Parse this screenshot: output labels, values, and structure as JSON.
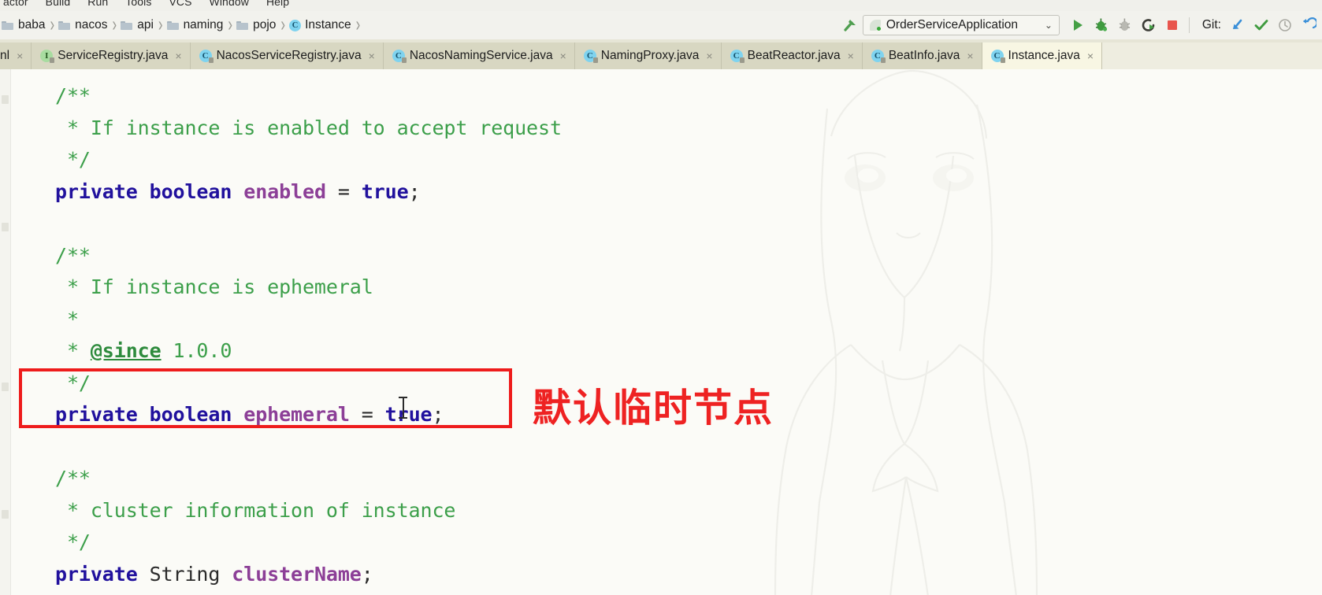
{
  "menubar": {
    "items": [
      "actor",
      "Build",
      "Run",
      "Tools",
      "VCS",
      "Window",
      "Help"
    ]
  },
  "breadcrumb": {
    "items": [
      {
        "label": "baba",
        "icon": "folder-icon"
      },
      {
        "label": "nacos",
        "icon": "folder-icon"
      },
      {
        "label": "api",
        "icon": "folder-icon"
      },
      {
        "label": "naming",
        "icon": "folder-icon"
      },
      {
        "label": "pojo",
        "icon": "folder-icon"
      },
      {
        "label": "Instance",
        "icon": "class-icon"
      }
    ],
    "separator": "›"
  },
  "toolbar": {
    "build_icon": "hammer-icon",
    "run_config": {
      "label": "OrderServiceApplication",
      "icon": "spring-boot-icon",
      "chevron": "⌄"
    },
    "run_icon": "run-icon",
    "debug_icon": "debug-icon",
    "coverage_icon": "coverage-icon",
    "rerun_icon": "rerun-icon",
    "stop_icon": "stop-icon",
    "git_label": "Git:",
    "git_update_icon": "update-project-icon",
    "git_commit_icon": "commit-icon",
    "git_history_icon": "history-icon",
    "git_revert_icon": "revert-icon"
  },
  "tabs": [
    {
      "label": "nl",
      "icon": "xml-icon",
      "active": false,
      "clipped": true
    },
    {
      "label": "ServiceRegistry.java",
      "icon": "interface-icon",
      "active": false,
      "clipped": false
    },
    {
      "label": "NacosServiceRegistry.java",
      "icon": "class-icon",
      "active": false,
      "clipped": false
    },
    {
      "label": "NacosNamingService.java",
      "icon": "class-icon",
      "active": false,
      "clipped": false
    },
    {
      "label": "NamingProxy.java",
      "icon": "class-icon",
      "active": false,
      "clipped": false
    },
    {
      "label": "BeatReactor.java",
      "icon": "class-icon",
      "active": false,
      "clipped": false
    },
    {
      "label": "BeatInfo.java",
      "icon": "class-icon",
      "active": false,
      "clipped": false
    },
    {
      "label": "Instance.java",
      "icon": "class-icon",
      "active": true,
      "clipped": false
    }
  ],
  "tab_close_glyph": "×",
  "editor": {
    "file": "Instance.java",
    "lines": [
      {
        "indent": 0,
        "tokens": [
          {
            "t": "/**",
            "c": "comment"
          }
        ]
      },
      {
        "indent": 0,
        "tokens": [
          {
            "t": " * If instance is enabled to accept request",
            "c": "comment"
          }
        ]
      },
      {
        "indent": 0,
        "tokens": [
          {
            "t": " */",
            "c": "comment"
          }
        ]
      },
      {
        "indent": 0,
        "tokens": [
          {
            "t": "private",
            "c": "kw"
          },
          {
            "t": " ",
            "c": "punct"
          },
          {
            "t": "boolean",
            "c": "kw"
          },
          {
            "t": " ",
            "c": "punct"
          },
          {
            "t": "enabled",
            "c": "field"
          },
          {
            "t": " = ",
            "c": "punct"
          },
          {
            "t": "true",
            "c": "kw"
          },
          {
            "t": ";",
            "c": "punct"
          }
        ]
      },
      {
        "indent": 0,
        "tokens": []
      },
      {
        "indent": 0,
        "tokens": [
          {
            "t": "/**",
            "c": "comment"
          }
        ]
      },
      {
        "indent": 0,
        "tokens": [
          {
            "t": " * If instance is ephemeral",
            "c": "comment"
          }
        ]
      },
      {
        "indent": 0,
        "tokens": [
          {
            "t": " *",
            "c": "comment"
          }
        ]
      },
      {
        "indent": 0,
        "tokens": [
          {
            "t": " * ",
            "c": "comment"
          },
          {
            "t": "@since",
            "c": "tag"
          },
          {
            "t": " 1.0.0",
            "c": "comment"
          }
        ]
      },
      {
        "indent": 0,
        "tokens": [
          {
            "t": " */",
            "c": "comment"
          }
        ]
      },
      {
        "indent": 0,
        "tokens": [
          {
            "t": "private",
            "c": "kw"
          },
          {
            "t": " ",
            "c": "punct"
          },
          {
            "t": "boolean",
            "c": "kw"
          },
          {
            "t": " ",
            "c": "punct"
          },
          {
            "t": "ephemeral",
            "c": "field"
          },
          {
            "t": " = ",
            "c": "punct"
          },
          {
            "t": "true",
            "c": "kw"
          },
          {
            "t": ";",
            "c": "punct"
          }
        ]
      },
      {
        "indent": 0,
        "tokens": []
      },
      {
        "indent": 0,
        "tokens": [
          {
            "t": "/**",
            "c": "comment"
          }
        ]
      },
      {
        "indent": 0,
        "tokens": [
          {
            "t": " * cluster information of instance",
            "c": "comment"
          }
        ]
      },
      {
        "indent": 0,
        "tokens": [
          {
            "t": " */",
            "c": "comment"
          }
        ]
      },
      {
        "indent": 0,
        "tokens": [
          {
            "t": "private",
            "c": "kw"
          },
          {
            "t": " ",
            "c": "punct"
          },
          {
            "t": "String",
            "c": "type"
          },
          {
            "t": " ",
            "c": "punct"
          },
          {
            "t": "clusterName",
            "c": "field"
          },
          {
            "t": ";",
            "c": "punct"
          }
        ]
      }
    ]
  },
  "annotation": {
    "text": "默认临时节点",
    "color": "#ee2222",
    "target_code": "private boolean ephemeral = true;"
  },
  "colors": {
    "comment": "#3c9f4a",
    "keyword": "#21119d",
    "field": "#8c3f97",
    "annotation_red": "#ee1c1c",
    "editor_bg": "#fbfbf7",
    "tab_bg": "#d8d7c2",
    "tab_active_bg": "#f8f6e3",
    "toolbar_bg": "#f2f2ed"
  }
}
